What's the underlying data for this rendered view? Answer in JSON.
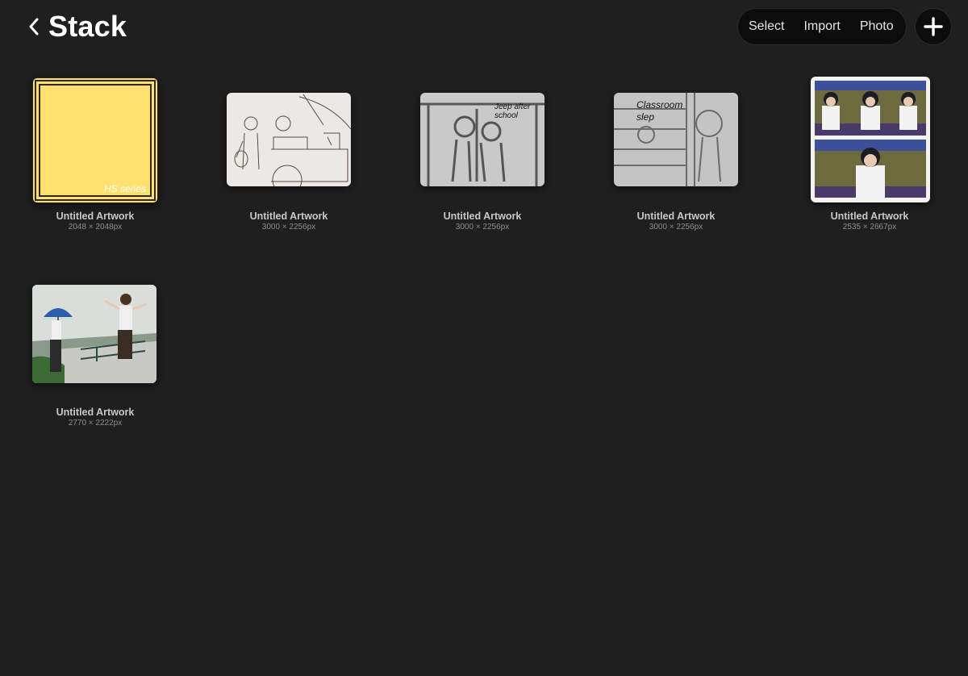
{
  "header": {
    "title": "Stack"
  },
  "toolbar": {
    "select_label": "Select",
    "import_label": "Import",
    "photo_label": "Photo"
  },
  "artworks": [
    {
      "name": "Untitled Artwork",
      "size": "2048 × 2048px",
      "caption": "HS series"
    },
    {
      "name": "Untitled Artwork",
      "size": "3000 × 2256px"
    },
    {
      "name": "Untitled Artwork",
      "size": "3000 × 2256px",
      "caption": "Jeep after school"
    },
    {
      "name": "Untitled Artwork",
      "size": "3000 × 2256px",
      "caption": "Classroom slep"
    },
    {
      "name": "Untitled Artwork",
      "size": "2535 × 2667px"
    },
    {
      "name": "Untitled Artwork",
      "size": "2770 × 2222px"
    }
  ],
  "colors": {
    "background": "#1f1f1f",
    "pill": "#0c0c0c",
    "cover_yellow": "#ffe070"
  }
}
